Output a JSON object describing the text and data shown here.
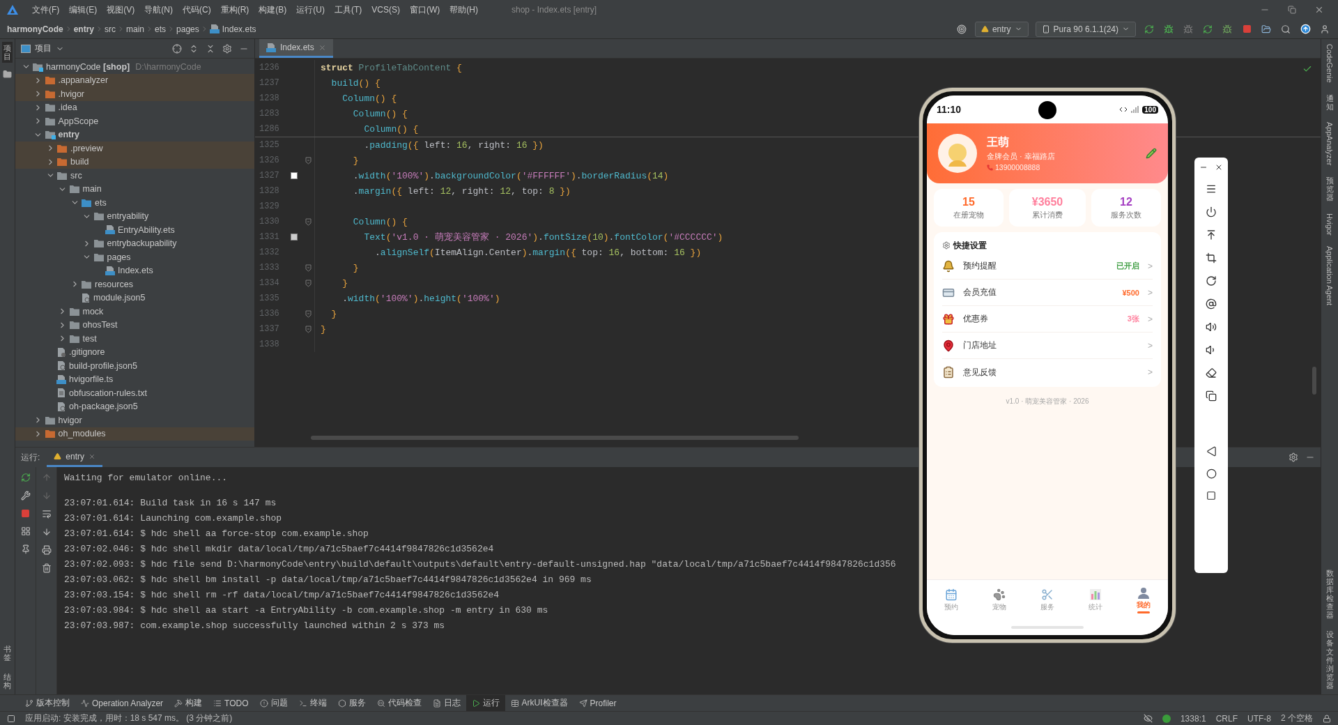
{
  "menu_bar": {
    "items": [
      "文件(F)",
      "编辑(E)",
      "视图(V)",
      "导航(N)",
      "代码(C)",
      "重构(R)",
      "构建(B)",
      "运行(U)",
      "工具(T)",
      "VCS(S)",
      "窗口(W)",
      "帮助(H)"
    ],
    "title": "shop - Index.ets [entry]"
  },
  "breadcrumb": [
    {
      "label": "harmonyCode",
      "bold": true
    },
    {
      "label": "entry",
      "bold": true
    },
    {
      "label": "src",
      "bold": false
    },
    {
      "label": "main",
      "bold": false
    },
    {
      "label": "ets",
      "bold": false
    },
    {
      "label": "pages",
      "bold": false
    },
    {
      "label": "Index.ets",
      "bold": false
    }
  ],
  "toolbar": {
    "run_config": "entry",
    "device": "Pura 90 6.1.1(24)"
  },
  "left_strip": {
    "top": [
      {
        "label": "项目",
        "selected": true
      }
    ],
    "bottom": [
      {
        "label": "书签",
        "selected": false
      },
      {
        "label": "结构",
        "selected": false
      }
    ]
  },
  "project_panel": {
    "title": "项目",
    "tree": [
      {
        "label": "harmonyCode **[shop]**",
        "path": "D:\\harmonyCode",
        "kind": "module",
        "expanded": true,
        "children": [
          {
            "label": ".appanalyzer",
            "kind": "excluded",
            "expanded": false
          },
          {
            "label": ".hvigor",
            "kind": "excluded",
            "expanded": false
          },
          {
            "label": ".idea",
            "kind": "folder",
            "expanded": false
          },
          {
            "label": "AppScope",
            "kind": "folder",
            "expanded": false
          },
          {
            "label": "entry",
            "kind": "module",
            "bold": true,
            "expanded": true,
            "children": [
              {
                "label": ".preview",
                "kind": "excluded",
                "expanded": false
              },
              {
                "label": "build",
                "kind": "excluded",
                "expanded": false
              },
              {
                "label": "src",
                "kind": "folder",
                "expanded": true,
                "children": [
                  {
                    "label": "main",
                    "kind": "folder",
                    "expanded": true,
                    "children": [
                      {
                        "label": "ets",
                        "kind": "source",
                        "expanded": true,
                        "children": [
                          {
                            "label": "entryability",
                            "kind": "folder",
                            "expanded": true,
                            "children": [
                              {
                                "label": "EntryAbility.ets",
                                "kind": "ets"
                              }
                            ]
                          },
                          {
                            "label": "entrybackupability",
                            "kind": "folder",
                            "expanded": false
                          },
                          {
                            "label": "pages",
                            "kind": "folder",
                            "expanded": true,
                            "children": [
                              {
                                "label": "Index.ets",
                                "kind": "ets"
                              }
                            ]
                          }
                        ]
                      },
                      {
                        "label": "resources",
                        "kind": "folder",
                        "expanded": false
                      },
                      {
                        "label": "module.json5",
                        "kind": "json"
                      }
                    ]
                  },
                  {
                    "label": "mock",
                    "kind": "folder",
                    "expanded": false
                  },
                  {
                    "label": "ohosTest",
                    "kind": "folder",
                    "expanded": false
                  },
                  {
                    "label": "test",
                    "kind": "folder",
                    "expanded": false
                  }
                ]
              },
              {
                "label": ".gitignore",
                "kind": "git"
              },
              {
                "label": "build-profile.json5",
                "kind": "json"
              },
              {
                "label": "hvigorfile.ts",
                "kind": "ts"
              },
              {
                "label": "obfuscation-rules.txt",
                "kind": "txt"
              },
              {
                "label": "oh-package.json5",
                "kind": "json"
              }
            ]
          },
          {
            "label": "hvigor",
            "kind": "folder",
            "expanded": false
          },
          {
            "label": "oh_modules",
            "kind": "excluded",
            "expanded": false
          }
        ]
      }
    ]
  },
  "editor": {
    "tabs": [
      {
        "label": "Index.ets",
        "selected": true
      }
    ],
    "sticky_lines": [
      {
        "number": "1236",
        "tokens": [
          {
            "t": "struct ",
            "kind": "kw"
          },
          {
            "t": "ProfileTabContent",
            "kind": "name"
          },
          {
            "t": " {",
            "kind": "br"
          }
        ]
      },
      {
        "number": "1237",
        "tokens": [
          {
            "t": "  build",
            "kind": "fn"
          },
          {
            "t": "() {",
            "kind": "br"
          }
        ]
      },
      {
        "number": "1238",
        "tokens": [
          {
            "t": "    Column",
            "kind": "fn"
          },
          {
            "t": "() {",
            "kind": "br"
          }
        ]
      },
      {
        "number": "1283",
        "tokens": [
          {
            "t": "      Column",
            "kind": "fn"
          },
          {
            "t": "() {",
            "kind": "br"
          }
        ]
      },
      {
        "number": "1286",
        "tokens": [
          {
            "t": "        Column",
            "kind": "fn"
          },
          {
            "t": "() {",
            "kind": "br"
          }
        ]
      }
    ],
    "lines": [
      {
        "number": "1325",
        "tokens": [
          {
            "t": "        ."
          },
          {
            "t": "padding",
            "kind": "fn"
          },
          {
            "t": "({",
            "kind": "br"
          },
          {
            "t": " left: "
          },
          {
            "t": "16",
            "kind": "num"
          },
          {
            "t": ", right: "
          },
          {
            "t": "16",
            "kind": "num"
          },
          {
            "t": " })",
            "kind": "br"
          }
        ]
      },
      {
        "number": "1326",
        "fold": true,
        "tokens": [
          {
            "t": "      }",
            "kind": "br"
          }
        ]
      },
      {
        "number": "1327",
        "color": "#ffffff",
        "tokens": [
          {
            "t": "      ."
          },
          {
            "t": "width",
            "kind": "fn"
          },
          {
            "t": "(",
            "kind": "br"
          },
          {
            "t": "'100%'",
            "kind": "str"
          },
          {
            "t": ")",
            "kind": "br"
          },
          {
            "t": "."
          },
          {
            "t": "backgroundColor",
            "kind": "fn"
          },
          {
            "t": "(",
            "kind": "br"
          },
          {
            "t": "'#FFFFFF'",
            "kind": "str"
          },
          {
            "t": ")",
            "kind": "br"
          },
          {
            "t": "."
          },
          {
            "t": "borderRadius",
            "kind": "fn"
          },
          {
            "t": "(",
            "kind": "br"
          },
          {
            "t": "14",
            "kind": "num"
          },
          {
            "t": ")",
            "kind": "br"
          }
        ]
      },
      {
        "number": "1328",
        "tokens": [
          {
            "t": "      ."
          },
          {
            "t": "margin",
            "kind": "fn"
          },
          {
            "t": "({",
            "kind": "br"
          },
          {
            "t": " left: "
          },
          {
            "t": "12",
            "kind": "num"
          },
          {
            "t": ", right: "
          },
          {
            "t": "12",
            "kind": "num"
          },
          {
            "t": ", top: "
          },
          {
            "t": "8",
            "kind": "num"
          },
          {
            "t": " })",
            "kind": "br"
          }
        ]
      },
      {
        "number": "1329"
      },
      {
        "number": "1330",
        "fold": true,
        "tokens": [
          {
            "t": "      Column",
            "kind": "fn"
          },
          {
            "t": "() {",
            "kind": "br"
          }
        ]
      },
      {
        "number": "1331",
        "color": "#cccccc",
        "tokens": [
          {
            "t": "        Text",
            "kind": "fn"
          },
          {
            "t": "(",
            "kind": "br"
          },
          {
            "t": "'v1.0 · 萌宠美容管家 · 2026'",
            "kind": "str"
          },
          {
            "t": ")",
            "kind": "br"
          },
          {
            "t": "."
          },
          {
            "t": "fontSize",
            "kind": "fn"
          },
          {
            "t": "(",
            "kind": "br"
          },
          {
            "t": "10",
            "kind": "num"
          },
          {
            "t": ")",
            "kind": "br"
          },
          {
            "t": "."
          },
          {
            "t": "fontColor",
            "kind": "fn"
          },
          {
            "t": "(",
            "kind": "br"
          },
          {
            "t": "'#CCCCCC'",
            "kind": "str"
          },
          {
            "t": ")",
            "kind": "br"
          }
        ]
      },
      {
        "number": "1332",
        "tokens": [
          {
            "t": "          ."
          },
          {
            "t": "alignSelf",
            "kind": "fn"
          },
          {
            "t": "(",
            "kind": "br"
          },
          {
            "t": "ItemAlign.Center"
          },
          {
            "t": ")",
            "kind": "br"
          },
          {
            "t": "."
          },
          {
            "t": "margin",
            "kind": "fn"
          },
          {
            "t": "({",
            "kind": "br"
          },
          {
            "t": " top: "
          },
          {
            "t": "16",
            "kind": "num"
          },
          {
            "t": ", bottom: "
          },
          {
            "t": "16",
            "kind": "num"
          },
          {
            "t": " })",
            "kind": "br"
          }
        ]
      },
      {
        "number": "1333",
        "fold": true,
        "tokens": [
          {
            "t": "      }",
            "kind": "br"
          }
        ]
      },
      {
        "number": "1334",
        "fold": true,
        "tokens": [
          {
            "t": "    }",
            "kind": "br"
          }
        ]
      },
      {
        "number": "1335",
        "tokens": [
          {
            "t": "    ."
          },
          {
            "t": "width",
            "kind": "fn"
          },
          {
            "t": "(",
            "kind": "br"
          },
          {
            "t": "'100%'",
            "kind": "str"
          },
          {
            "t": ")",
            "kind": "br"
          },
          {
            "t": "."
          },
          {
            "t": "height",
            "kind": "fn"
          },
          {
            "t": "(",
            "kind": "br"
          },
          {
            "t": "'100%'",
            "kind": "str"
          },
          {
            "t": ")",
            "kind": "br"
          }
        ]
      },
      {
        "number": "1336",
        "fold": true,
        "tokens": [
          {
            "t": "  }",
            "kind": "br"
          }
        ]
      },
      {
        "number": "1337",
        "fold": true,
        "tokens": [
          {
            "t": "}",
            "kind": "br"
          }
        ]
      },
      {
        "number": "1338"
      }
    ]
  },
  "run_panel": {
    "label": "运行:",
    "tabs": [
      {
        "label": "entry",
        "selected": true
      }
    ],
    "output": [
      [
        "Waiting for emulator online..."
      ],
      [
        "23:07:01.614: Build task in 16 s 147 ms",
        "23:07:01.614: Launching com.example.shop",
        "23:07:01.614: $ hdc shell aa force-stop com.example.shop",
        "23:07:02.046: $ hdc shell mkdir data/local/tmp/a71c5baef7c4414f9847826c1d3562e4",
        "23:07:02.093: $ hdc file send D:\\harmonyCode\\entry\\build\\default\\outputs\\default\\entry-default-unsigned.hap \"data/local/tmp/a71c5baef7c4414f9847826c1d356",
        "23:07:03.062: $ hdc shell bm install -p data/local/tmp/a71c5baef7c4414f9847826c1d3562e4 in 969 ms",
        "23:07:03.154: $ hdc shell rm -rf data/local/tmp/a71c5baef7c4414f9847826c1d3562e4",
        "23:07:03.984: $ hdc shell aa start -a EntryAbility -b com.example.shop -m entry in 630 ms",
        "23:07:03.987: com.example.shop successfully launched within 2 s 373 ms"
      ]
    ]
  },
  "tool_tabs": [
    {
      "label": "版本控制",
      "kind": "branch",
      "selected": false
    },
    {
      "label": "Operation Analyzer",
      "kind": "chart",
      "selected": false
    },
    {
      "label": "构建",
      "kind": "hammer",
      "selected": false
    },
    {
      "label": "TODO",
      "kind": "list",
      "selected": false
    },
    {
      "label": "问题",
      "kind": "alert",
      "selected": false
    },
    {
      "label": "终端",
      "kind": "terminal",
      "selected": false
    },
    {
      "label": "服务",
      "kind": "hex",
      "selected": false
    },
    {
      "label": "代码检查",
      "kind": "inspect",
      "selected": false
    },
    {
      "label": "日志",
      "kind": "log",
      "selected": false
    },
    {
      "label": "运行",
      "kind": "run",
      "selected": true
    },
    {
      "label": "ArkUI检查器",
      "kind": "table",
      "selected": false
    },
    {
      "label": "Profiler",
      "kind": "send",
      "selected": false
    }
  ],
  "status_bar": {
    "message": "应用启动: 安装完成，用时：18 s 547 ms。 (3 分钟之前)",
    "items": [
      "1338:1",
      "CRLF",
      "UTF-8",
      "2 个空格"
    ]
  },
  "right_strip": {
    "top": [
      {
        "label": "CodeGenie",
        "kind": "rotated",
        "selected": false
      },
      {
        "label": "通知",
        "kind": "stacked",
        "selected": false
      },
      {
        "label": "AppAnalyzer",
        "kind": "rotated",
        "selected": false
      },
      {
        "label": "预览器",
        "kind": "stacked",
        "selected": false
      },
      {
        "label": "Hvigor",
        "kind": "rotated",
        "selected": false
      },
      {
        "label": "Application Agent",
        "kind": "rotated",
        "selected": false
      }
    ],
    "bottom": [
      {
        "label": "数据库检查器",
        "kind": "stacked",
        "selected": false
      },
      {
        "label": "设备文件浏览器",
        "kind": "stacked",
        "selected": false
      }
    ]
  },
  "phone": {
    "time": "11:10",
    "battery": "100",
    "user": {
      "name": "王萌",
      "subtitle": "金牌会员 · 幸福路店",
      "phone": "13900008888"
    },
    "stats": [
      {
        "value": "15",
        "label": "在册宠物",
        "color": "#ff6a2b"
      },
      {
        "value": "¥3650",
        "label": "累计消费",
        "color": "#ff7f9c"
      },
      {
        "value": "12",
        "label": "服务次数",
        "color": "#a43fc2"
      }
    ],
    "settings": {
      "title": "快捷设置",
      "rows": [
        {
          "label": "预约提醒",
          "kind": "bell",
          "value": "已开启",
          "color": "#43a047",
          "chevron": ">"
        },
        {
          "label": "会员充值",
          "kind": "card",
          "value": "¥500",
          "color": "#ff6a2b",
          "chevron": ">"
        },
        {
          "label": "优惠券",
          "kind": "gift",
          "value": "3张",
          "color": "#ff7f9c",
          "chevron": ">"
        },
        {
          "label": "门店地址",
          "kind": "pin",
          "chevron": ">"
        },
        {
          "label": "意见反馈",
          "kind": "clipboard",
          "chevron": ">"
        }
      ]
    },
    "footer": "v1.0 · 萌宠美容管家 · 2026",
    "tabs": [
      {
        "label": "预约",
        "kind": "calendar",
        "selected": false
      },
      {
        "label": "宠物",
        "kind": "paw",
        "selected": false
      },
      {
        "label": "服务",
        "kind": "scissors",
        "selected": false
      },
      {
        "label": "统计",
        "kind": "chart",
        "selected": false
      },
      {
        "label": "我的",
        "kind": "person",
        "selected": true
      }
    ]
  }
}
